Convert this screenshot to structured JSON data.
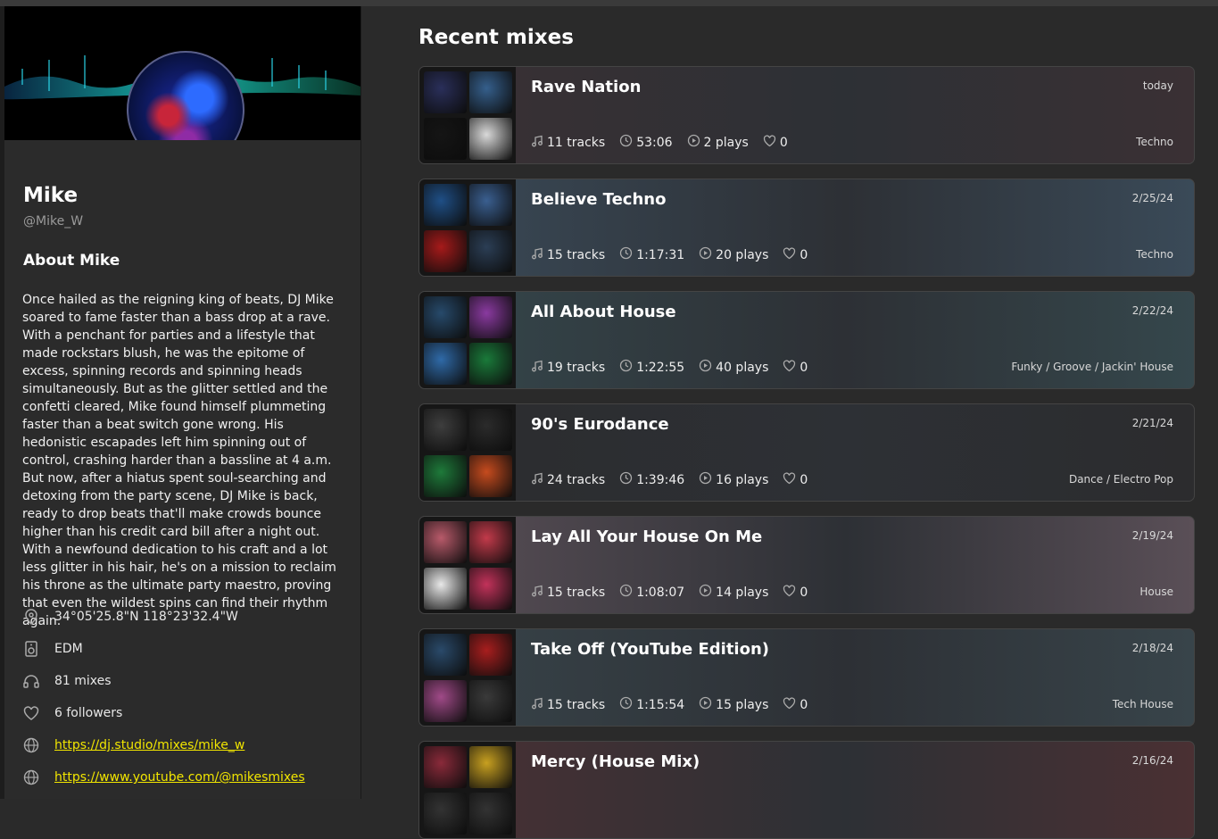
{
  "profile": {
    "name": "Mike",
    "handle": "@Mike_W",
    "about_title": "About Mike",
    "bio": "Once hailed as the reigning king of beats, DJ Mike soared to fame faster than a bass drop at a rave. With a penchant for parties and a lifestyle that made rockstars blush, he was the epitome of excess, spinning records and spinning heads simultaneously. But as the glitter settled and the confetti cleared, Mike found himself plummeting faster than a beat switch gone wrong. His hedonistic escapades left him spinning out of control, crashing harder than a bassline at 4 a.m. But now, after a hiatus spent soul-searching and detoxing from the party scene, DJ Mike is back, ready to drop beats that'll make crowds bounce higher than his credit card bill after a night out. With a newfound dedication to his craft and a lot less glitter in his hair, he's on a mission to reclaim his throne as the ultimate party maestro, proving that even the wildest spins can find their rhythm again.",
    "location": "34°05'25.8\"N 118°23'32.4\"W",
    "genre": "EDM",
    "mixes": "81 mixes",
    "followers": "6 followers",
    "link1": "https://dj.studio/mixes/mike_w",
    "link2": "https://www.youtube.com/@mikesmixes"
  },
  "section_title": "Recent mixes",
  "mixes": [
    {
      "title": "Rave Nation",
      "date": "today",
      "tracks": "11 tracks",
      "duration": "53:06",
      "plays": "2 plays",
      "likes": "0",
      "genre": "Techno",
      "tint": "#3a3034",
      "thumbs": [
        "#2a2f5a",
        "#355f8c",
        "#151515",
        "#d9d9d9"
      ]
    },
    {
      "title": "Believe Techno",
      "date": "2/25/24",
      "tracks": "15 tracks",
      "duration": "1:17:31",
      "plays": "20 plays",
      "likes": "0",
      "genre": "Techno",
      "tint": "#3a4a58",
      "thumbs": [
        "#1f4f86",
        "#3a5f90",
        "#a61a1a",
        "#2b3e55"
      ]
    },
    {
      "title": "All About House",
      "date": "2/22/24",
      "tracks": "19 tracks",
      "duration": "1:22:55",
      "plays": "40 plays",
      "likes": "0",
      "genre": "Funky / Groove / Jackin' House",
      "tint": "#35474c",
      "thumbs": [
        "#274a6b",
        "#8a3aa0",
        "#2f6aa8",
        "#1a7a3a"
      ]
    },
    {
      "title": "90's Eurodance",
      "date": "2/21/24",
      "tracks": "24 tracks",
      "duration": "1:39:46",
      "plays": "16 plays",
      "likes": "0",
      "genre": "Dance / Electro Pop",
      "tint": "#2c2c2e",
      "thumbs": [
        "#3e3e3e",
        "#2b2b2b",
        "#1e7a3a",
        "#c64b1e"
      ]
    },
    {
      "title": "Lay All Your House On Me",
      "date": "2/19/24",
      "tracks": "15 tracks",
      "duration": "1:08:07",
      "plays": "14 plays",
      "likes": "0",
      "genre": "House",
      "tint": "#5a4f57",
      "thumbs": [
        "#b85a6a",
        "#c23a4a",
        "#e8e8e8",
        "#c2325a"
      ]
    },
    {
      "title": "Take Off (YouTube Edition)",
      "date": "2/18/24",
      "tracks": "15 tracks",
      "duration": "1:15:54",
      "plays": "15 plays",
      "likes": "0",
      "genre": "Tech House",
      "tint": "#38444a",
      "thumbs": [
        "#2a4a6a",
        "#a81e1e",
        "#a04a88",
        "#3a3a3a"
      ]
    },
    {
      "title": "Mercy (House Mix)",
      "date": "2/16/24",
      "tracks": "",
      "duration": "",
      "plays": "",
      "likes": "",
      "genre": "",
      "tint": "#4a3033",
      "thumbs": [
        "#8a2a3a",
        "#c8a020",
        "#333333",
        "#333333"
      ]
    }
  ]
}
